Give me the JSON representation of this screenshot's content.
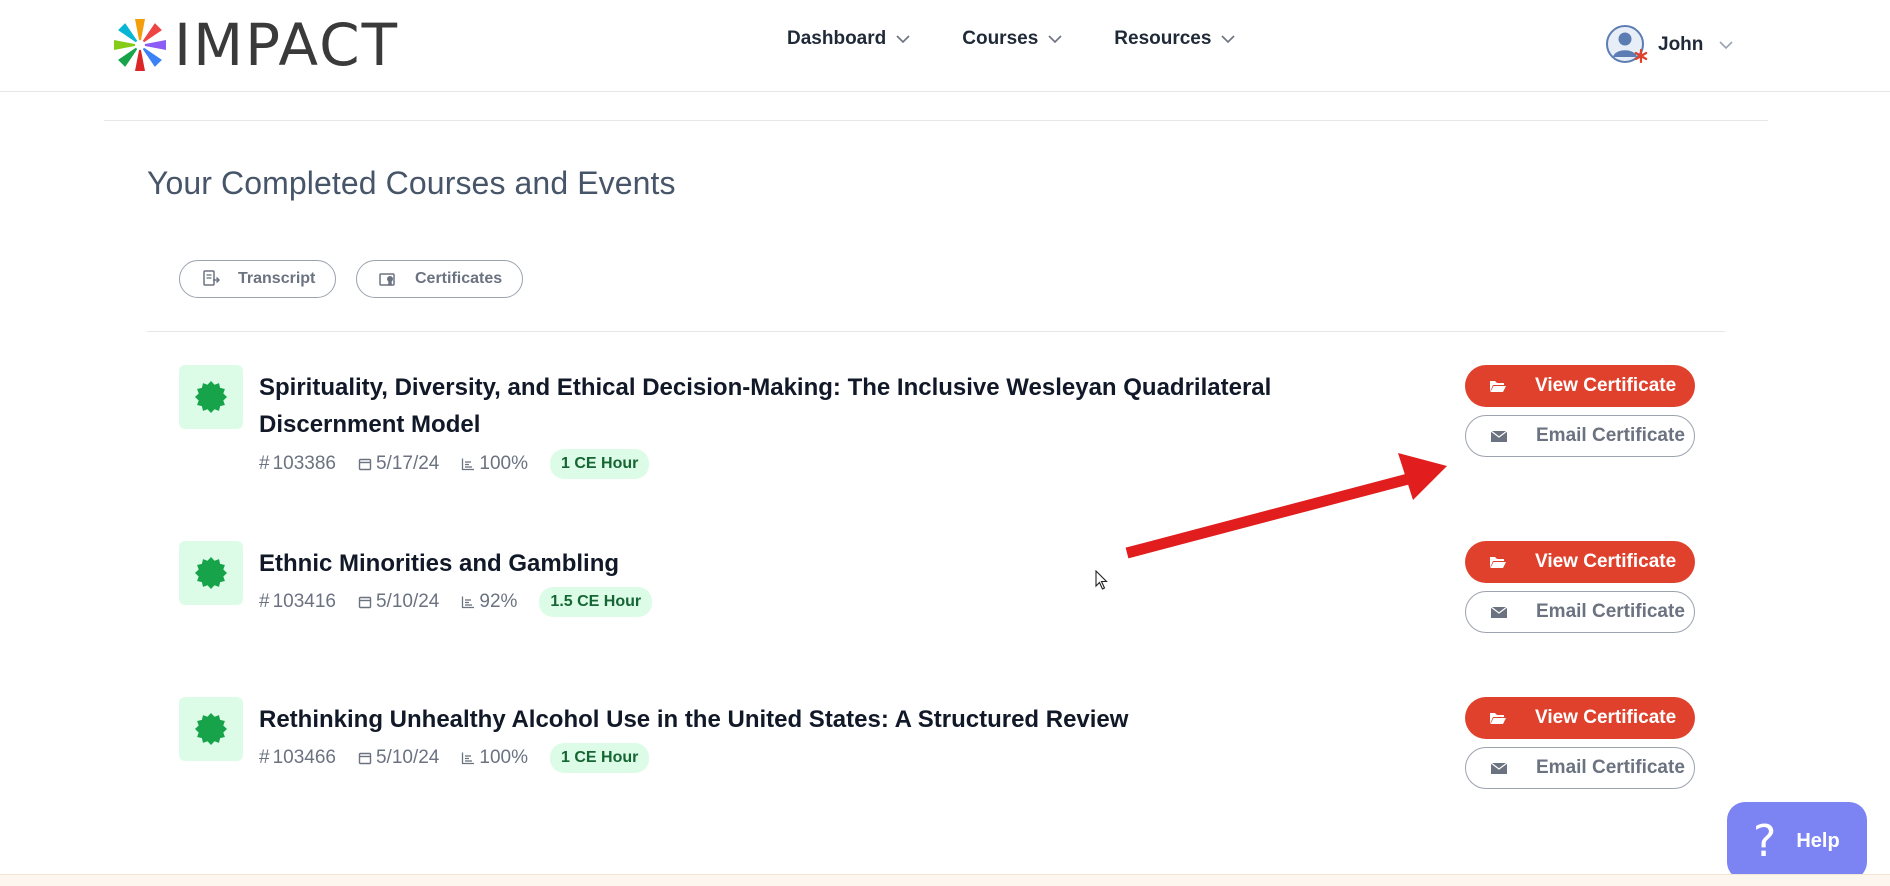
{
  "brand": {
    "name": "IMPACT",
    "icon": "starburst-logo-icon"
  },
  "nav": {
    "items": [
      {
        "label": "Dashboard",
        "icon": "chevron-down-icon"
      },
      {
        "label": "Courses",
        "icon": "chevron-down-icon"
      },
      {
        "label": "Resources",
        "icon": "chevron-down-icon"
      }
    ]
  },
  "user": {
    "name": "John",
    "icon": "user-avatar-icon"
  },
  "page": {
    "title": "Your Completed Courses and Events"
  },
  "filters": {
    "transcript": "Transcript",
    "certificates": "Certificates"
  },
  "courses": [
    {
      "title": "Spirituality, Diversity, and Ethical Decision-Making: The Inclusive Wesleyan Quadrilateral Discernment Model",
      "id": "103386",
      "date": "5/17/24",
      "score": "100%",
      "ce": "1 CE Hour",
      "view_label": "View Certificate",
      "email_label": "Email Certificate"
    },
    {
      "title": "Ethnic Minorities and Gambling",
      "id": "103416",
      "date": "5/10/24",
      "score": "92%",
      "ce": "1.5 CE Hour",
      "view_label": "View Certificate",
      "email_label": "Email Certificate"
    },
    {
      "title": "Rethinking Unhealthy Alcohol Use in the United States: A Structured Review",
      "id": "103466",
      "date": "5/10/24",
      "score": "100%",
      "ce": "1 CE Hour",
      "view_label": "View Certificate",
      "email_label": "Email Certificate"
    }
  ],
  "meta": {
    "hash_symbol": "#"
  },
  "help": {
    "label": "Help",
    "glyph": "?"
  },
  "colors": {
    "accent_red": "#e0412c",
    "badge_green": "#16a34a",
    "badge_bg": "#dcfce7",
    "help_bg": "#7c83f3"
  }
}
